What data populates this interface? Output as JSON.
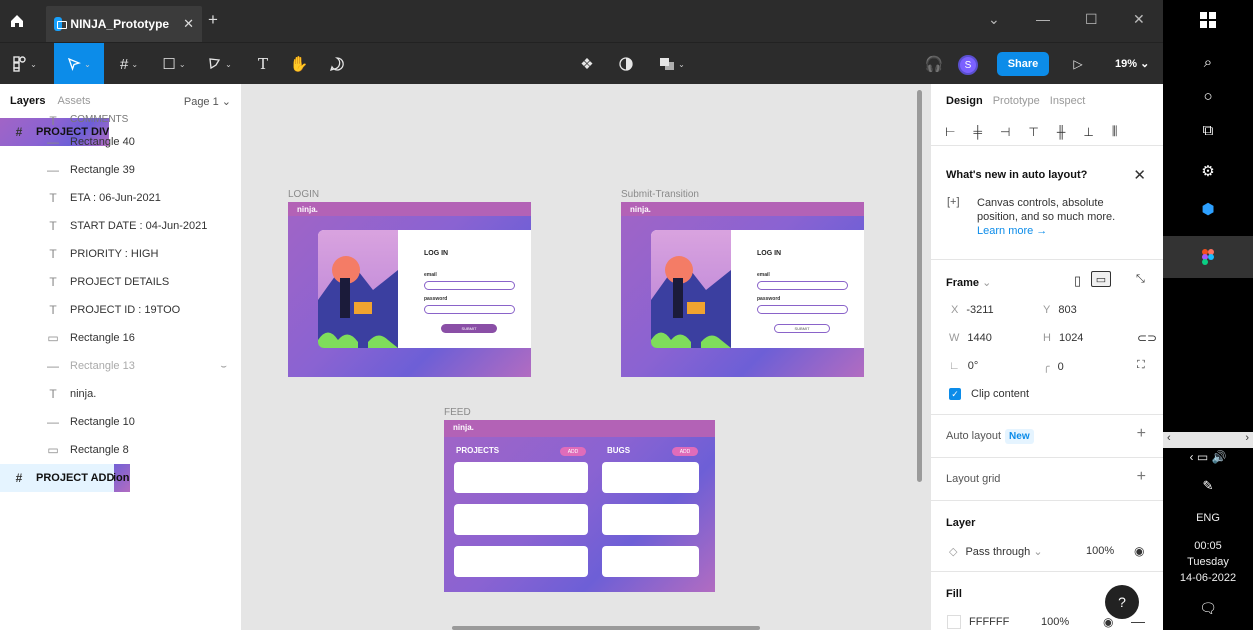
{
  "titlebar": {
    "tab_title": "NINJA_Prototype",
    "tab_close": "✕",
    "new_tab": "+",
    "min": "—",
    "max": "☐",
    "close": "✕",
    "dropdown": "⌄"
  },
  "toolbar": {
    "share_label": "Share",
    "avatar_initial": "S",
    "zoom": "19%",
    "zoom_chev": "⌄"
  },
  "layers_panel": {
    "tab_layers": "Layers",
    "tab_assets": "Assets",
    "page": "Page 1 ⌄",
    "top_frame": "PROJECT DIV",
    "cut_item": "COMMENTS",
    "children": [
      {
        "icon": "line",
        "label": "Rectangle 40"
      },
      {
        "icon": "line",
        "label": "Rectangle 39"
      },
      {
        "icon": "text",
        "label": "ETA : 06-Jun-2021"
      },
      {
        "icon": "text",
        "label": "START DATE : 04-Jun-2021"
      },
      {
        "icon": "text",
        "label": "PRIORITY : HIGH"
      },
      {
        "icon": "text",
        "label": "PROJECT DETAILS"
      },
      {
        "icon": "text",
        "label": "PROJECT ID : 19TOO"
      },
      {
        "icon": "rect",
        "label": "Rectangle 16"
      },
      {
        "icon": "line",
        "label": "Rectangle 13"
      },
      {
        "icon": "text",
        "label": "ninja."
      },
      {
        "icon": "line",
        "label": "Rectangle 10"
      },
      {
        "icon": "rect",
        "label": "Rectangle 8"
      }
    ],
    "frames": [
      "FEED",
      "LOGIN",
      "Submit-Transition",
      "PROJECT ADD",
      "PROJECT ADD"
    ]
  },
  "canvas": {
    "login_label": "LOGIN",
    "submit_label": "Submit-Transition",
    "feed_label": "FEED",
    "brand": "ninja.",
    "login_title": "LOG IN",
    "email_label": "email",
    "password_label": "password",
    "submit": "SUBMIT",
    "projects": "PROJECTS",
    "bugs": "BUGS",
    "add": "ADD"
  },
  "design_panel": {
    "tab_design": "Design",
    "tab_prototype": "Prototype",
    "tab_inspect": "Inspect",
    "whats_new_title": "What's new in auto layout?",
    "whats_new_body": "Canvas controls, absolute position, and so much more.",
    "learn_more": "Learn more →",
    "frame_label": "Frame",
    "x_label": "X",
    "x_value": "-3211",
    "y_label": "Y",
    "y_value": "803",
    "w_label": "W",
    "w_value": "1440",
    "h_label": "H",
    "h_value": "1024",
    "rotation": "0°",
    "radius": "0",
    "clip_content": "Clip content",
    "auto_layout": "Auto layout",
    "auto_layout_badge": "New",
    "layout_grid": "Layout grid",
    "layer_title": "Layer",
    "blend_mode": "Pass through",
    "layer_opacity": "100%",
    "fill_title": "Fill",
    "fill_hex": "FFFFFF",
    "fill_opacity": "100%",
    "help": "?"
  },
  "taskbar": {
    "lang": "ENG",
    "time": "00:05",
    "day": "Tuesday",
    "date": "14-06-2022"
  },
  "colors": {
    "accent": "#0c8ce9",
    "frame_purple": "#a164c6",
    "add_pill": "#e06cba"
  }
}
